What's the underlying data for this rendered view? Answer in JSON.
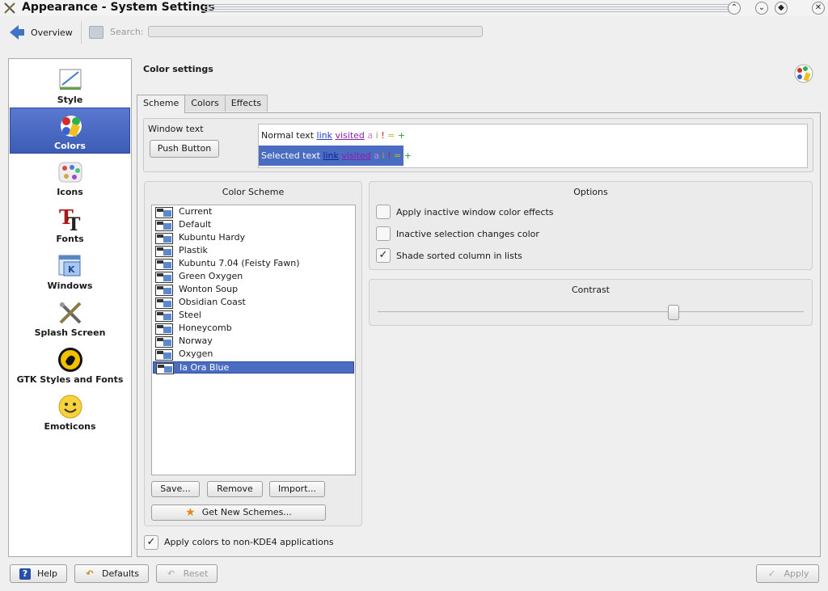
{
  "window": {
    "title": "Appearance - System Settings"
  },
  "toolbar": {
    "overview_label": "Overview",
    "search_label": "Search:",
    "search_value": ""
  },
  "sidebar": {
    "items": [
      {
        "label": "Style",
        "icon": "style-icon",
        "selected": false
      },
      {
        "label": "Colors",
        "icon": "colors-icon",
        "selected": true
      },
      {
        "label": "Icons",
        "icon": "icons-icon",
        "selected": false
      },
      {
        "label": "Fonts",
        "icon": "fonts-icon",
        "selected": false
      },
      {
        "label": "Windows",
        "icon": "windows-icon",
        "selected": false
      },
      {
        "label": "Splash Screen",
        "icon": "splash-screen-icon",
        "selected": false
      },
      {
        "label": "GTK Styles and Fonts",
        "icon": "gtk-icon",
        "selected": false
      },
      {
        "label": "Emoticons",
        "icon": "emoticons-icon",
        "selected": false
      }
    ]
  },
  "main": {
    "title": "Color settings",
    "tabs": [
      {
        "label": "Scheme",
        "active": true
      },
      {
        "label": "Colors",
        "active": false
      },
      {
        "label": "Effects",
        "active": false
      }
    ],
    "preview": {
      "window_text_label": "Window text",
      "push_button_label": "Push Button",
      "normal_text": "Normal text",
      "selected_text": "Selected text",
      "link": "link",
      "visited": "visited",
      "active": "a",
      "inactive": "i",
      "negative": "!",
      "neutral": "=",
      "positive": "+"
    },
    "color_scheme": {
      "title": "Color Scheme",
      "items": [
        "Current",
        "Default",
        "Kubuntu Hardy",
        "Plastik",
        "Kubuntu 7.04 (Feisty Fawn)",
        "Green Oxygen",
        "Wonton Soup",
        "Obsidian Coast",
        "Steel",
        "Honeycomb",
        "Norway",
        "Oxygen",
        "Ia Ora Blue"
      ],
      "selected": "Ia Ora Blue",
      "save_label": "Save...",
      "remove_label": "Remove",
      "import_label": "Import...",
      "get_new_label": "Get New Schemes..."
    },
    "options": {
      "title": "Options",
      "inactive_effects": {
        "label": "Apply inactive window color effects",
        "checked": false
      },
      "inactive_selection": {
        "label": "Inactive selection changes color",
        "checked": false
      },
      "shade_sorted": {
        "label": "Shade sorted column in lists",
        "checked": true
      }
    },
    "contrast": {
      "title": "Contrast",
      "value": 0.7
    },
    "apply_non_kde": {
      "label": "Apply colors to non-KDE4 applications",
      "checked": true
    }
  },
  "footer": {
    "help_label": "Help",
    "defaults_label": "Defaults",
    "reset_label": "Reset",
    "apply_label": "Apply"
  },
  "colors": {
    "selection": "#4a6cc1",
    "link": "#1d3ec5",
    "visited": "#8722a5"
  }
}
